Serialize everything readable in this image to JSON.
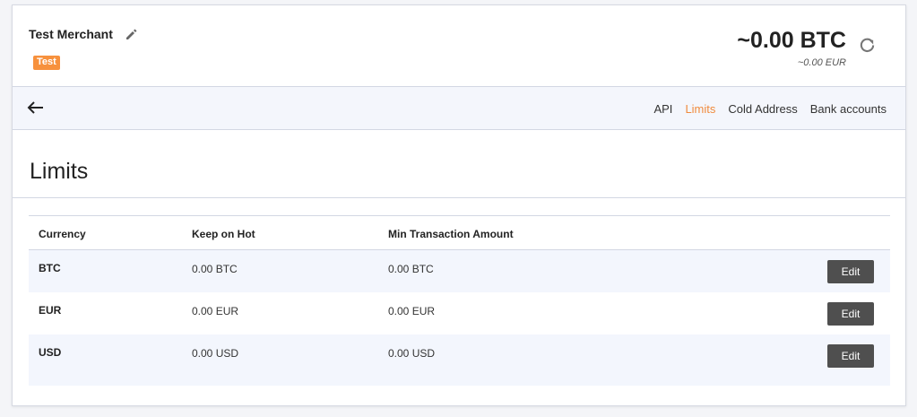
{
  "header": {
    "merchant_name": "Test Merchant",
    "badge": "Test",
    "balance_btc": "~0.00 BTC",
    "balance_eur": "~0.00 EUR",
    "accent_color": "#f7913d"
  },
  "nav": {
    "links": [
      {
        "label": "API",
        "active": false
      },
      {
        "label": "Limits",
        "active": true
      },
      {
        "label": "Cold Address",
        "active": false
      },
      {
        "label": "Bank accounts",
        "active": false
      }
    ]
  },
  "page": {
    "title": "Limits"
  },
  "table": {
    "columns": [
      "Currency",
      "Keep on Hot",
      "Min Transaction Amount"
    ],
    "rows": [
      {
        "currency": "BTC",
        "keep_on_hot": "0.00 BTC",
        "min_tx": "0.00 BTC",
        "action": "Edit"
      },
      {
        "currency": "EUR",
        "keep_on_hot": "0.00 EUR",
        "min_tx": "0.00 EUR",
        "action": "Edit"
      },
      {
        "currency": "USD",
        "keep_on_hot": "0.00 USD",
        "min_tx": "0.00 USD",
        "action": "Edit"
      }
    ]
  }
}
